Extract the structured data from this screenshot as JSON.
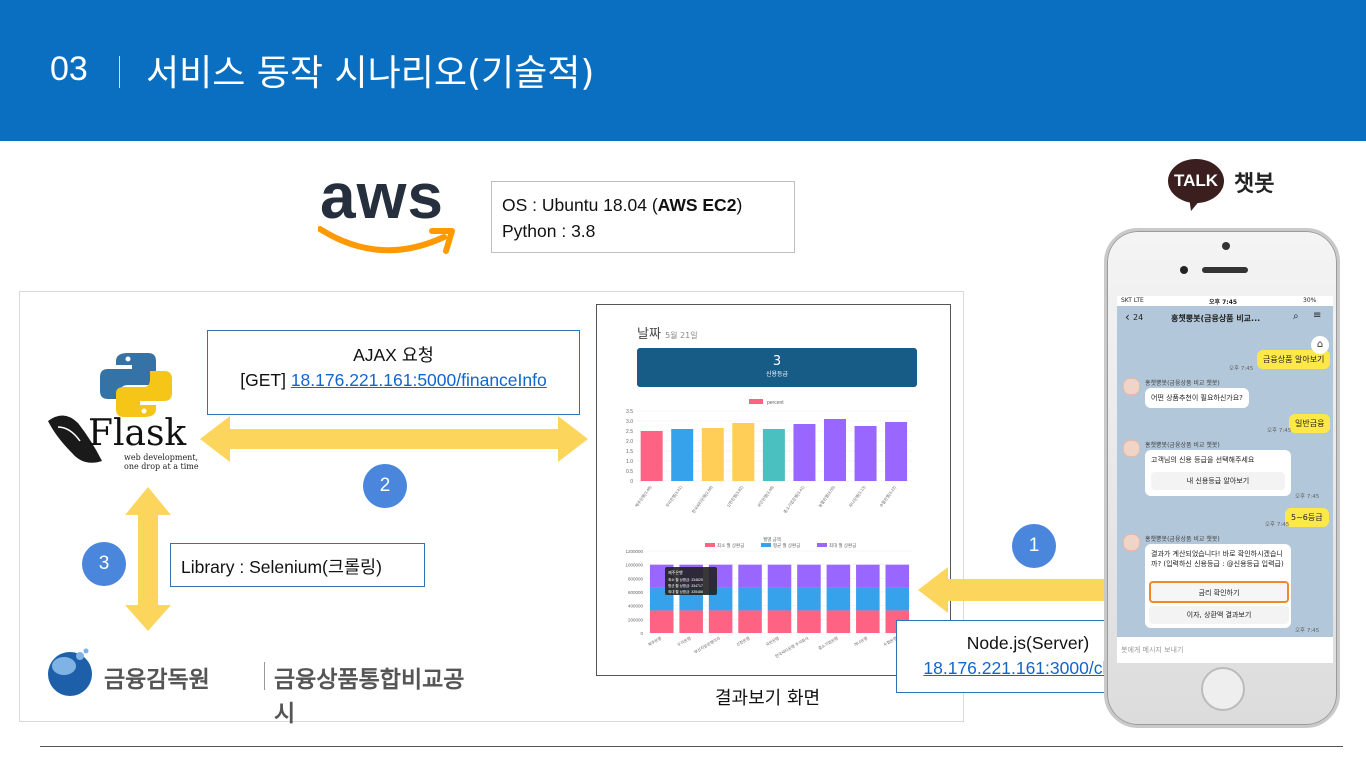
{
  "header": {
    "number": "03",
    "title": "서비스 동작 시나리오(기술적)"
  },
  "aws": {
    "logo_text": "aws",
    "os_line_prefix": "OS : Ubuntu  18.04 (",
    "os_line_bold": "AWS EC2",
    "os_line_suffix": ")",
    "python_line": "Python : 3.8"
  },
  "talk": {
    "badge": "TALK",
    "label": "챗봇"
  },
  "flask": {
    "name": "Flask",
    "tagline_1": "web development,",
    "tagline_2": "one drop at a time"
  },
  "ajax": {
    "title": "AJAX 요청",
    "prefix": "[GET] ",
    "url": "18.176.221.161:5000/financeInfo"
  },
  "library": {
    "text": "Library : Selenium(크롤링)"
  },
  "fss": {
    "org": "금융감독원",
    "service": "금융상품통합비교공시"
  },
  "node": {
    "title": "Node.js(Server)",
    "url": "18.176.221.161:3000/chart"
  },
  "steps": {
    "one": "1",
    "two": "2",
    "three": "3"
  },
  "result": {
    "caption": "결과보기 화면",
    "date_label": "날짜",
    "date_value": "5월 21일",
    "grade_value": "3",
    "grade_label": "신용등급"
  },
  "colors": {
    "header": "#0a6fc0",
    "arrow": "#fcd65c",
    "step": "#4a86dc",
    "link": "#1166cc"
  },
  "chart_data": [
    {
      "type": "bar",
      "legend": [
        "percent"
      ],
      "categories": [
        "제주은행(3.48)",
        "우리은행(3.41)",
        "한국씨티은행(2.88)",
        "신한은행(3.82)",
        "국민은행(3.48)",
        "중소기업은행(3.41)",
        "농협은행(3.55)",
        "하나은행(3.13)",
        "수협은행(3.22)"
      ],
      "values": [
        2.5,
        2.6,
        2.65,
        2.9,
        2.6,
        2.85,
        3.1,
        2.75,
        2.95
      ],
      "ylim": [
        0,
        3.5
      ],
      "yticks": [
        "3.5",
        "3.0",
        "2.5",
        "2.0",
        "1.5",
        "1.0",
        "0.5",
        "0"
      ],
      "colors": [
        "#ff6384",
        "#36a2eb",
        "#ffce56",
        "#ffce56",
        "#4bc0c0",
        "#9966ff",
        "#9966ff",
        "#9966ff",
        "#9966ff"
      ]
    },
    {
      "type": "bar",
      "stacked": true,
      "title": "월별 금액",
      "legend": [
        "최소 월 상환금",
        "평균 월 상환금",
        "최대 월 상환금"
      ],
      "categories": [
        "제주은행",
        "우리은행",
        "부산지방은행이자",
        "신한은행",
        "국민은행",
        "한국씨티은행 주식회사",
        "중소기업은행",
        "하나은행",
        "수협은행"
      ],
      "series": [
        {
          "name": "최소 월 상환금",
          "values": [
            330000,
            330000,
            330000,
            330000,
            330000,
            330000,
            330000,
            330000,
            330000
          ]
        },
        {
          "name": "평균 월 상환금",
          "values": [
            334717,
            334717,
            334717,
            334717,
            334717,
            334717,
            334717,
            334717,
            334717
          ]
        },
        {
          "name": "최대 월 상환금",
          "values": [
            335000,
            335000,
            335000,
            335000,
            335000,
            335000,
            335000,
            335000,
            335000
          ]
        }
      ],
      "ylim": [
        0,
        1200000
      ],
      "yticks": [
        "1200000",
        "1000000",
        "800000",
        "600000",
        "400000",
        "200000",
        "0"
      ],
      "tooltip": {
        "title": "제주은행",
        "line1": "최소 월 상환금: 334625",
        "line2": "평균 월 상환금: 334717",
        "line3": "최대 월 상환금: 335486"
      },
      "colors": [
        "#ff6384",
        "#36a2eb",
        "#9966ff"
      ]
    }
  ],
  "phone": {
    "status_left": "SKT  LTE",
    "status_time": "오후 7:45",
    "status_right": "30%",
    "back": "24",
    "chat_title": "홍챗뿡봇(금융상품 비교...",
    "bot_name": "홍챗뿡봇(금융상품 비교 챗봇)",
    "msg_top_user": "금융상품 알아보기",
    "msg_q1": "어떤 상품추천이 필요하신가요?",
    "msg_u1": "일반금융",
    "msg_q2": "고객님의 신용 등급을 선택해주세요",
    "btn_q2": "내 신용등급 알아보기",
    "msg_u2": "5~6등급",
    "msg_q3": "결과가 계산되었습니다! 바로 확인하시겠습니까? (입력하신 신용등급 : @신용등급 입력급)",
    "btn_q3a": "금리 확인하기",
    "btn_q3b": "이자, 상환액 결과보기",
    "time": "오후 7:45",
    "input_placeholder": "봇에게 메시지 보내기"
  }
}
